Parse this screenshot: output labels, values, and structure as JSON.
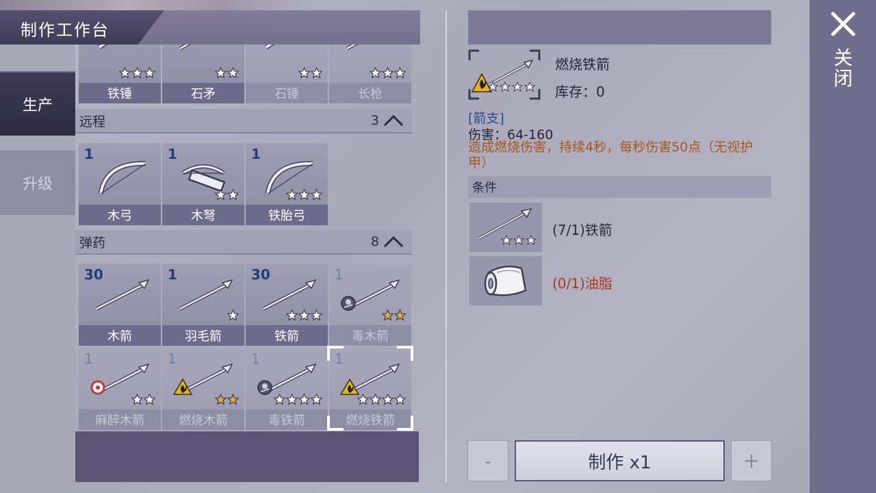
{
  "title": "制作工作台",
  "nav": {
    "produce": "生产",
    "upgrade": "升级"
  },
  "top_row": [
    {
      "name": "铁锤",
      "stars": 3,
      "star_color": "white",
      "dim": false,
      "icon": "hammer-icon"
    },
    {
      "name": "石矛",
      "stars": 2,
      "star_color": "white",
      "dim": false,
      "icon": "spear-icon"
    },
    {
      "name": "石锤",
      "stars": 2,
      "star_color": "white",
      "dim": true,
      "icon": "hammer-icon"
    },
    {
      "name": "长枪",
      "stars": 3,
      "star_color": "white",
      "dim": true,
      "icon": "spear-icon"
    }
  ],
  "sections": {
    "ranged": {
      "label": "远程",
      "count": "3"
    },
    "ammo": {
      "label": "弹药",
      "count": "8"
    }
  },
  "ranged_items": [
    {
      "name": "木弓",
      "count": "1",
      "stars": 0,
      "icon": "bow-icon"
    },
    {
      "name": "木弩",
      "count": "1",
      "stars": 2,
      "icon": "crossbow-icon"
    },
    {
      "name": "铁胎弓",
      "count": "1",
      "stars": 3,
      "icon": "bow-icon"
    }
  ],
  "ammo_items": [
    {
      "name": "木箭",
      "count": "30",
      "stars": 0,
      "dim": false,
      "badge": "",
      "star_color": "white"
    },
    {
      "name": "羽毛箭",
      "count": "1",
      "stars": 1,
      "dim": false,
      "badge": "",
      "star_color": "white"
    },
    {
      "name": "铁箭",
      "count": "30",
      "stars": 3,
      "dim": false,
      "badge": "",
      "star_color": "white"
    },
    {
      "name": "毒木箭",
      "count": "1",
      "stars": 2,
      "dim": true,
      "badge": "poison",
      "star_color": "gold"
    },
    {
      "name": "麻醉木箭",
      "count": "1",
      "stars": 2,
      "dim": true,
      "badge": "stun",
      "star_color": "white"
    },
    {
      "name": "燃烧木箭",
      "count": "1",
      "stars": 2,
      "dim": true,
      "badge": "fire",
      "star_color": "gold"
    },
    {
      "name": "毒铁箭",
      "count": "1",
      "stars": 4,
      "dim": true,
      "badge": "poison",
      "star_color": "white"
    },
    {
      "name": "燃烧铁箭",
      "count": "1",
      "stars": 4,
      "dim": true,
      "badge": "fire",
      "star_color": "white",
      "selected": true
    }
  ],
  "detail": {
    "name": "燃烧铁箭",
    "stock": "库存：0",
    "category": "[箭支]",
    "damage": "伤害：64-160",
    "description": "造成燃烧伤害，持续4秒，每秒伤害50点（无视护甲）",
    "conditions_label": "条件",
    "materials": [
      {
        "text": "(7/1)铁箭",
        "color": "#2a2a3c",
        "icon": "iron-arrow-icon"
      },
      {
        "text": "(0/1)油脂",
        "color": "#a83a1c",
        "icon": "grease-icon"
      }
    ]
  },
  "actions": {
    "minus": "-",
    "make": "制作 x1",
    "plus": "+"
  },
  "close": {
    "label": "关闭"
  }
}
